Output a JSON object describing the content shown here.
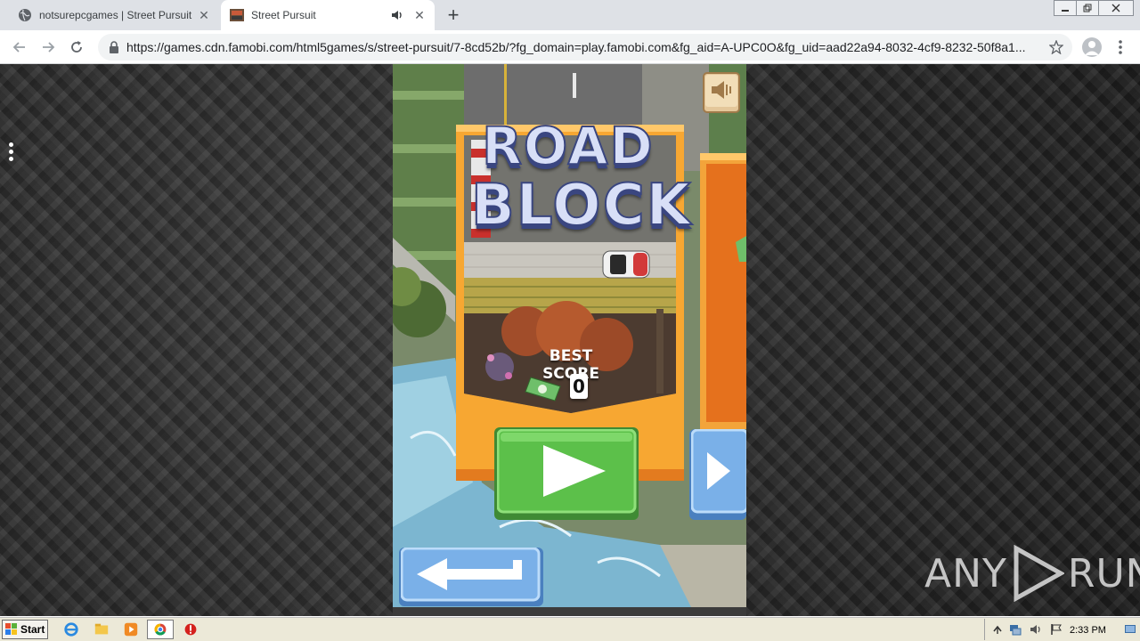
{
  "browser": {
    "tabs": [
      {
        "title": "notsurepcgames | Street Pursuit",
        "active": false
      },
      {
        "title": "Street Pursuit",
        "active": true
      }
    ],
    "url": "https://games.cdn.famobi.com/html5games/s/street-pursuit/7-8cd52b/?fg_domain=play.famobi.com&fg_aid=A-UPC0O&fg_uid=aad22a94-8032-4cf9-8232-50f8a1..."
  },
  "game": {
    "title_line1": "ROAD",
    "title_line2": "BLOCK",
    "best_score_label": "BEST SCORE",
    "best_score_value": "0"
  },
  "watermark": {
    "left": "ANY",
    "right": "RUN"
  },
  "taskbar": {
    "start_label": "Start",
    "clock": "2:33 PM"
  },
  "colors": {
    "panel_orange": "#f0a030",
    "play_green": "#5cc04a",
    "button_blue": "#7ab0e8",
    "title_fill": "#d8dff7",
    "title_outline": "#3a4680"
  }
}
